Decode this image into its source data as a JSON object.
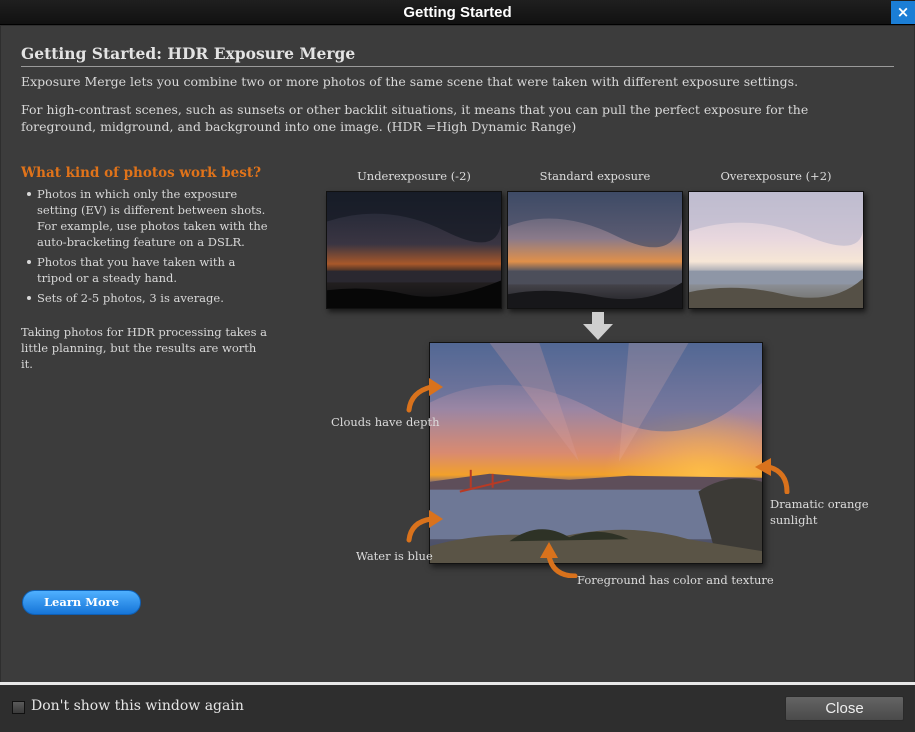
{
  "window": {
    "title": "Getting Started",
    "close_glyph": "×"
  },
  "main": {
    "heading": "Getting Started: HDR Exposure Merge",
    "intro": "Exposure Merge lets you combine two or more photos of the same scene that were taken with different exposure settings.",
    "detail": "For high-contrast scenes, such as sunsets or other backlit situations, it means that you can pull the perfect exposure for the foreground, midground, and background into one image. (HDR =High Dynamic Range)"
  },
  "sidebar": {
    "subheading": "What kind of photos work best?",
    "bullets": [
      "Photos in which only the exposure setting (EV) is different between shots. For example, use photos taken with the auto-bracketing feature on a DSLR.",
      "Photos that you have taken with a tripod or a steady hand.",
      "Sets of 2-5 photos, 3 is average."
    ],
    "tip": "Taking photos for HDR processing takes a little planning, but the results are worth it.",
    "learn_more": "Learn More"
  },
  "diagram": {
    "captions": [
      "Underexposure (-2)",
      "Standard exposure",
      "Overexposure (+2)"
    ],
    "callouts": {
      "clouds": "Clouds have depth",
      "water": "Water is blue",
      "sunlight": "Dramatic orange sunlight",
      "foreground": "Foreground has color and texture"
    }
  },
  "footer": {
    "checkbox_label": "Don't show this window again",
    "checkbox_checked": false,
    "close_label": "Close"
  },
  "colors": {
    "accent": "#e0731a",
    "link_blue": "#1675d8",
    "titlebar_close": "#1b7ed6"
  },
  "icons": [
    "close-icon",
    "down-arrow-icon",
    "curved-arrow-icon",
    "checkbox-icon"
  ]
}
